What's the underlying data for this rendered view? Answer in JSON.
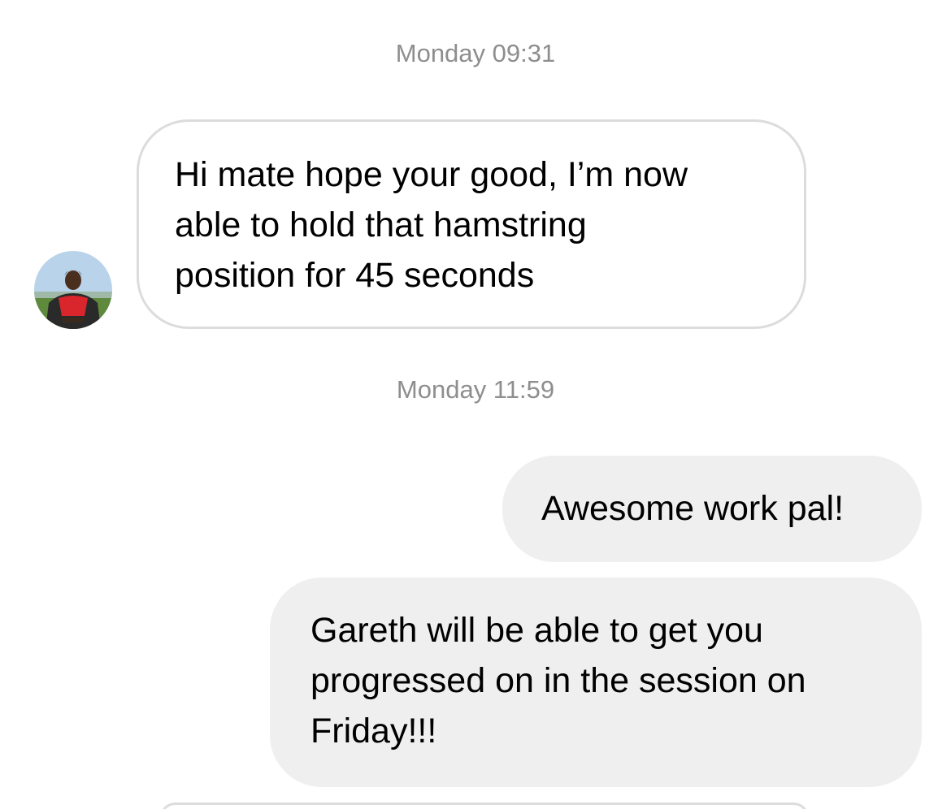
{
  "thread": {
    "messages": [
      {
        "timestamp": "Monday 09:31",
        "direction": "incoming",
        "text": "Hi mate hope your good, I’m now\nable to hold that hamstring\nposition for 45 seconds",
        "avatar_icon": "contact-avatar-photo"
      },
      {
        "timestamp": "Monday 11:59",
        "direction": "outgoing",
        "text": "Awesome work pal!"
      },
      {
        "direction": "outgoing",
        "text": "Gareth will be able to get you\nprogressed on in the session on\nFriday!!!"
      }
    ]
  },
  "colors": {
    "incoming_border": "#dcdcdc",
    "outgoing_bg": "#efefef",
    "timestamp_text": "#8e8e8e"
  }
}
